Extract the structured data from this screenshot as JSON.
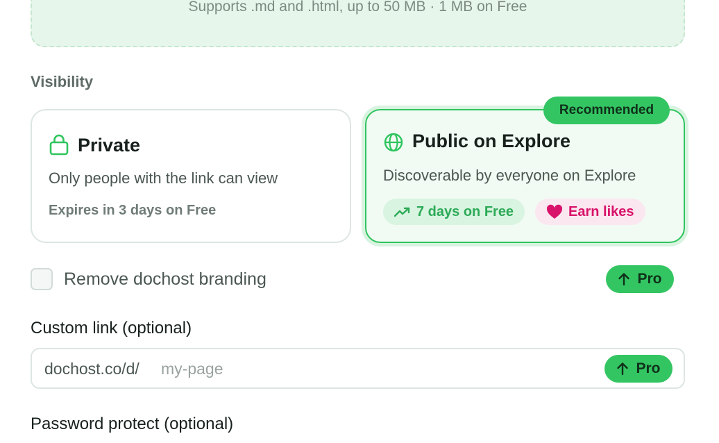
{
  "upload": {
    "hint": "Supports .md and .html, up to 50 MB · 1 MB on Free"
  },
  "visibility": {
    "label": "Visibility",
    "private": {
      "title": "Private",
      "icon": "lock-icon",
      "description": "Only people with the link can view",
      "note": "Expires in 3 days on Free"
    },
    "public": {
      "badge": "Recommended",
      "title": "Public on Explore",
      "icon": "globe-icon",
      "description": "Discoverable by everyone on Explore",
      "pill_days": "7 days on Free",
      "pill_likes": "Earn likes"
    }
  },
  "branding": {
    "checkbox_label": "Remove dochost branding",
    "checked": false,
    "pro_label": "Pro"
  },
  "custom_link": {
    "label": "Custom link (optional)",
    "prefix": "dochost.co/d/",
    "placeholder": "my-page",
    "value": "",
    "pro_label": "Pro"
  },
  "password": {
    "label": "Password protect (optional)"
  },
  "colors": {
    "accent": "#33c562",
    "accent_dark": "#2fc45e",
    "likes": "#d8126a",
    "dropzone_bg": "#e6f6ea"
  }
}
